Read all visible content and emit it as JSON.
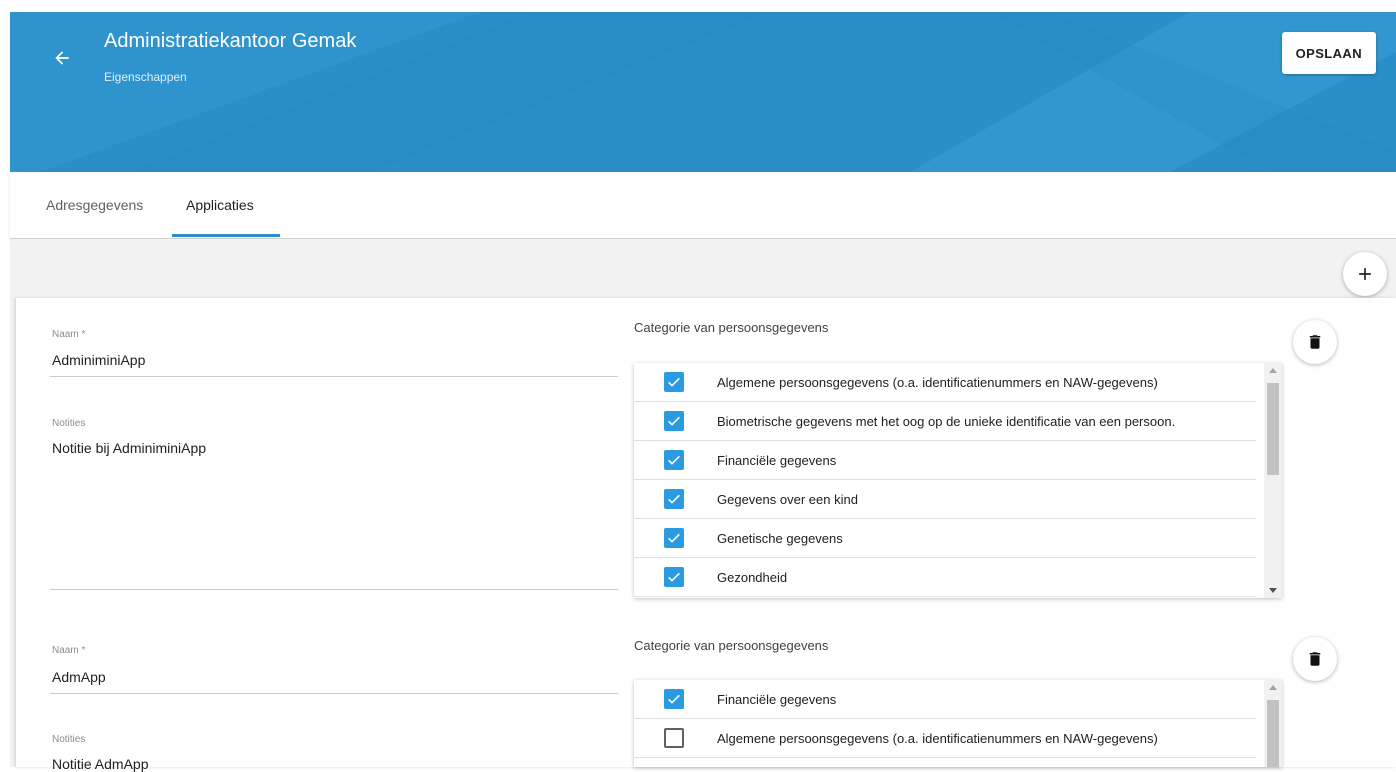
{
  "header": {
    "title": "Administratiekantoor Gemak",
    "subtitle": "Eigenschappen",
    "save_label": "OPSLAAN",
    "accent_color": "#2a8fc9"
  },
  "tabs": [
    {
      "label": "Adresgegevens",
      "active": false
    },
    {
      "label": "Applicaties",
      "active": true
    }
  ],
  "applications": [
    {
      "name_label": "Naam *",
      "name_value": "AdminiminiApp",
      "notes_label": "Notities",
      "notes_value": "Notitie bij AdminiminiApp",
      "category_label": "Categorie van persoonsgegevens",
      "categories": [
        {
          "label": "Algemene persoonsgegevens (o.a. identificatienummers en NAW-gegevens)",
          "checked": true
        },
        {
          "label": "Biometrische gegevens met het oog op de unieke identificatie van een persoon.",
          "checked": true
        },
        {
          "label": "Financiële gegevens",
          "checked": true
        },
        {
          "label": "Gegevens over een kind",
          "checked": true
        },
        {
          "label": "Genetische gegevens",
          "checked": true
        },
        {
          "label": "Gezondheid",
          "checked": true
        }
      ]
    },
    {
      "name_label": "Naam *",
      "name_value": "AdmApp",
      "notes_label": "Notities",
      "notes_value": "Notitie AdmApp",
      "category_label": "Categorie van persoonsgegevens",
      "categories": [
        {
          "label": "Financiële gegevens",
          "checked": true
        },
        {
          "label": "Algemene persoonsgegevens (o.a. identificatienummers en NAW-gegevens)",
          "checked": false
        },
        {
          "label": "",
          "checked": false
        }
      ]
    }
  ]
}
